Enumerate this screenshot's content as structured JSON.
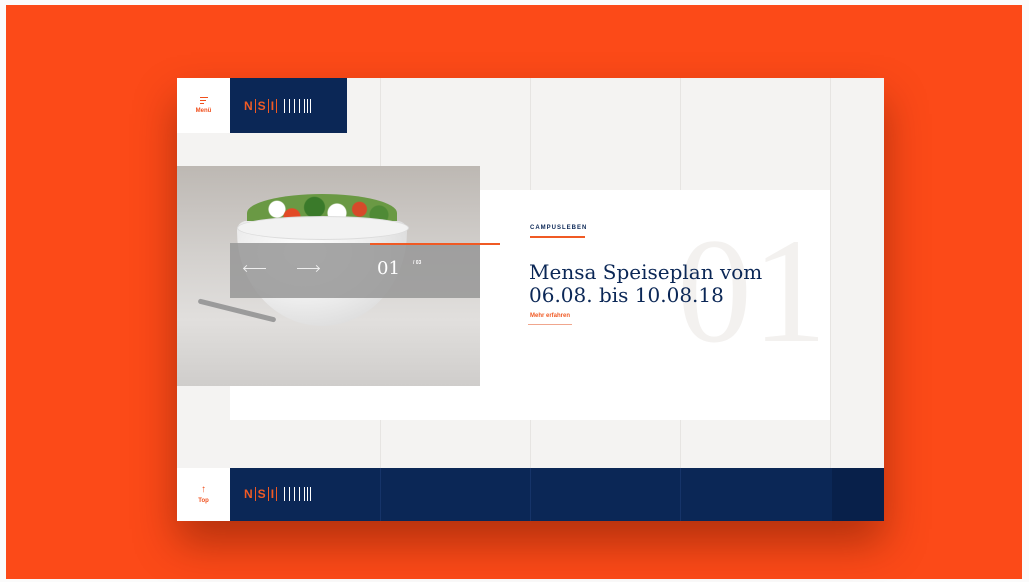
{
  "nav": {
    "menu_label": "Menü",
    "top_label": "Top",
    "top_arrow": "↑"
  },
  "logo": {
    "letters": [
      "N",
      "S",
      "I"
    ]
  },
  "slider": {
    "current": "01",
    "total": "/ 03",
    "big_number": "01"
  },
  "article": {
    "category": "CAMPUSLEBEN",
    "headline": "Mensa Speiseplan vom 06.08. bis 10.08.18",
    "more_link": "Mehr erfahren"
  },
  "colors": {
    "accent": "#f05a24",
    "navy": "#0b2756",
    "background": "#fc4a18"
  },
  "icons": [
    "menu-icon",
    "arrow-left-icon",
    "arrow-right-icon",
    "arrow-up-icon"
  ]
}
